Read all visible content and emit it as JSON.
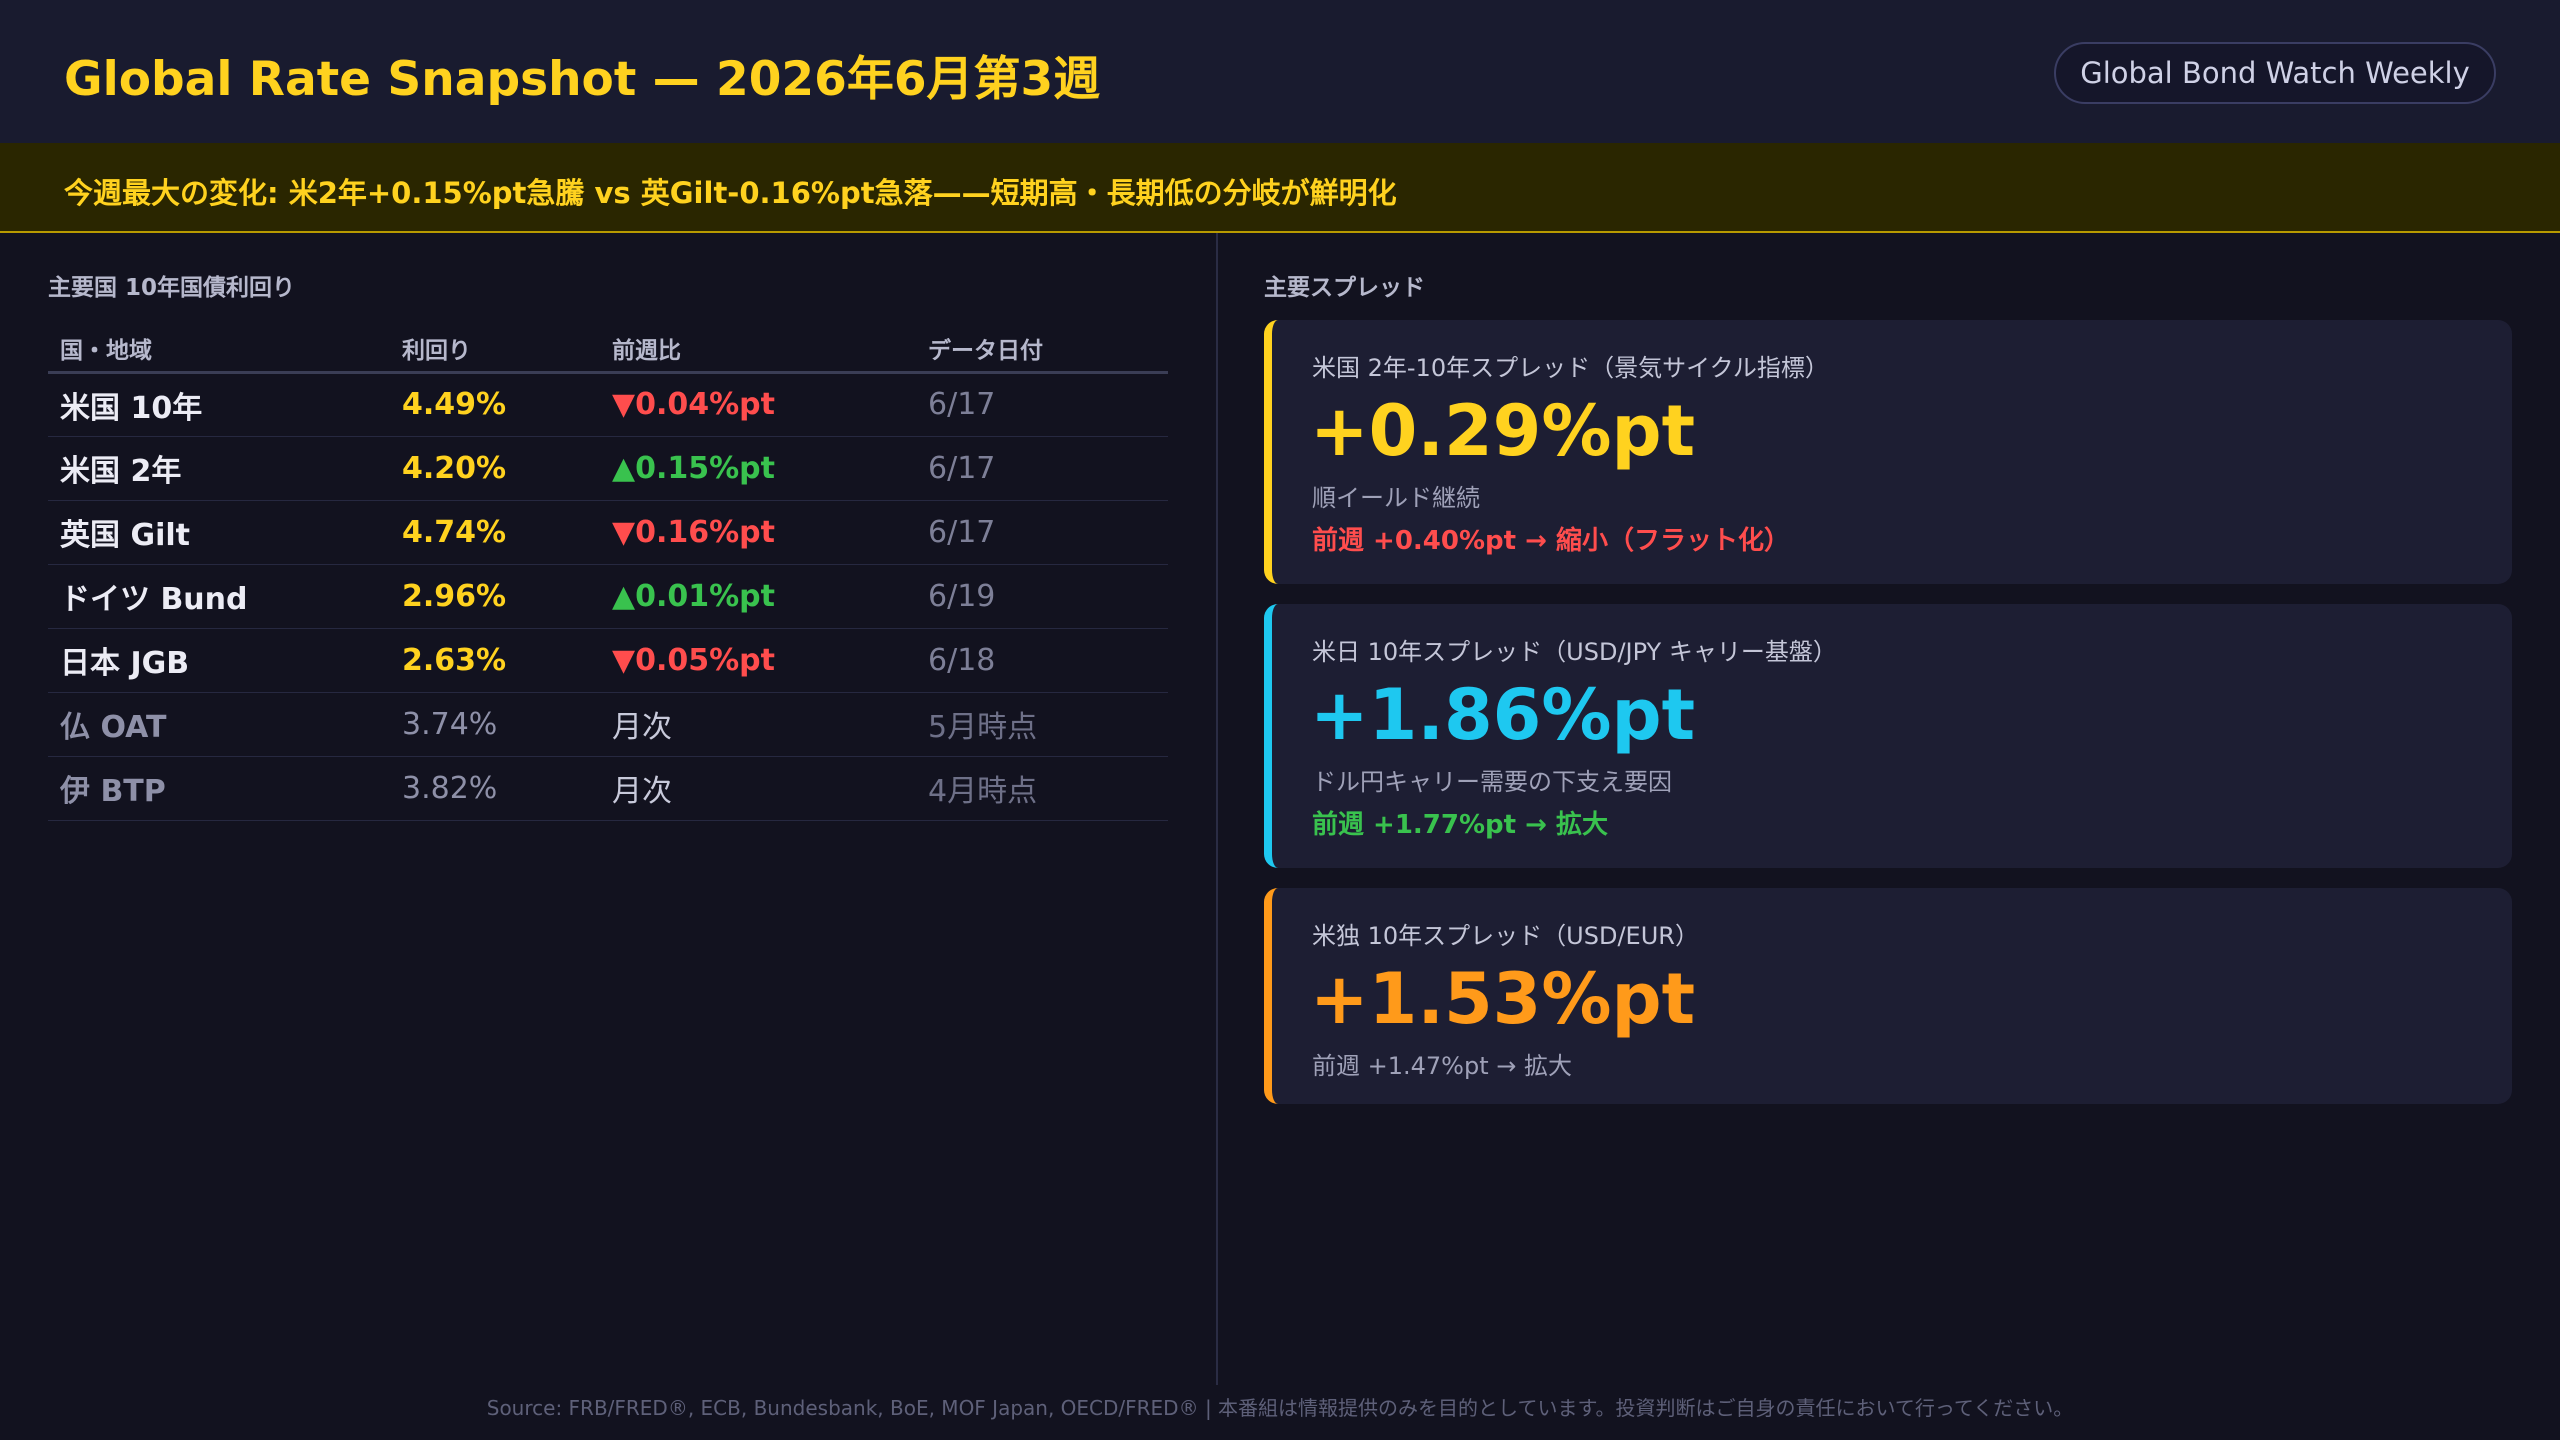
{
  "header": {
    "title": "Global Rate Snapshot — 2026年6月第3週",
    "badge": "Global Bond Watch Weekly"
  },
  "alert": {
    "text": "今週最大の変化: 米2年+0.15%pt急騰 vs 英Gilt-0.16%pt急落——短期高・長期低の分岐が鮮明化"
  },
  "table": {
    "title": "主要国 10年国債利回り",
    "headers": [
      "国・地域",
      "利回り",
      "前週比",
      "データ日付"
    ],
    "rows": [
      {
        "country": "米国 10年",
        "yield": "4.49%",
        "change": "▼0.04%pt",
        "date": "6/17"
      },
      {
        "country": "米国 2年",
        "yield": "4.20%",
        "change": "▲0.15%pt",
        "date": "6/17"
      },
      {
        "country": "英国 Gilt",
        "yield": "4.74%",
        "change": "▼0.16%pt",
        "date": "6/17"
      },
      {
        "country": "ドイツ Bund",
        "yield": "2.96%",
        "change": "▲0.01%pt",
        "date": "6/19"
      },
      {
        "country": "日本 JGB",
        "yield": "2.63%",
        "change": "▼0.05%pt",
        "date": "6/18"
      },
      {
        "country": "仏 OAT",
        "yield": "3.74%",
        "change": "月次",
        "date": "5月時点"
      },
      {
        "country": "伊 BTP",
        "yield": "3.82%",
        "change": "月次",
        "date": "4月時点"
      }
    ]
  },
  "spreads": {
    "title": "主要スプレッド",
    "cards": [
      {
        "label": "米国 2年-10年スプレッド（景気サイクル指標）",
        "value": "+0.29%pt",
        "note": "順イールド継続",
        "delta": "前週 +0.40%pt → 縮小（フラット化）"
      },
      {
        "label": "米日 10年スプレッド（USD/JPY キャリー基盤）",
        "value": "+1.86%pt",
        "note": "ドル円キャリー需要の下支え要因",
        "delta": "前週 +1.77%pt → 拡大"
      },
      {
        "label": "米独 10年スプレッド（USD/EUR）",
        "value": "+1.53%pt",
        "note": "前週 +1.47%pt → 拡大"
      }
    ]
  },
  "footer": {
    "text": "Source: FRB/FRED®, ECB, Bundesbank, BoE, MOF Japan, OECD/FRED® | 本番組は情報提供のみを目的としています。投資判断はご自身の責任において行ってください。"
  },
  "colors": {
    "accent_yellow": "#ffd21f",
    "down_red": "#ff4d4d",
    "up_green": "#39c24e",
    "card_cyan": "#1ec8f0",
    "card_orange": "#ff9a1a"
  }
}
